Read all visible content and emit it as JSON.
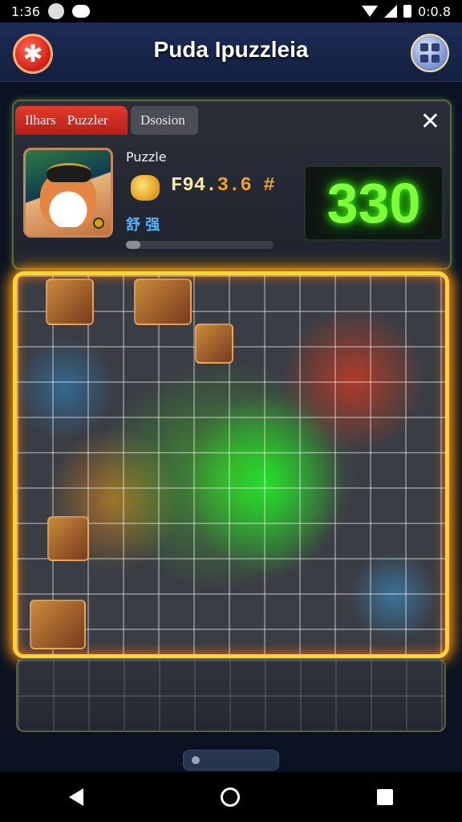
{
  "status_bar": {
    "time": "1:36",
    "battery_text": "0:0.8"
  },
  "header": {
    "title": "Puda Ipuzzleia",
    "close_icon": "close-x-icon",
    "menu_icon": "grid-menu-icon"
  },
  "panel": {
    "tabs": [
      {
        "label": "Ilhars"
      },
      {
        "label": "Puzzler"
      },
      {
        "label": "Dsosion"
      }
    ],
    "label": "Puzzle",
    "score_main": "F94.",
    "score_hi": "3.6 #",
    "sub_text": "舒 强",
    "progress": 0.1,
    "counter": "330"
  },
  "colors": {
    "accent_green": "#7dff3a",
    "frame_yellow": "#ffd43b",
    "tab_red": "#e23b2b"
  }
}
